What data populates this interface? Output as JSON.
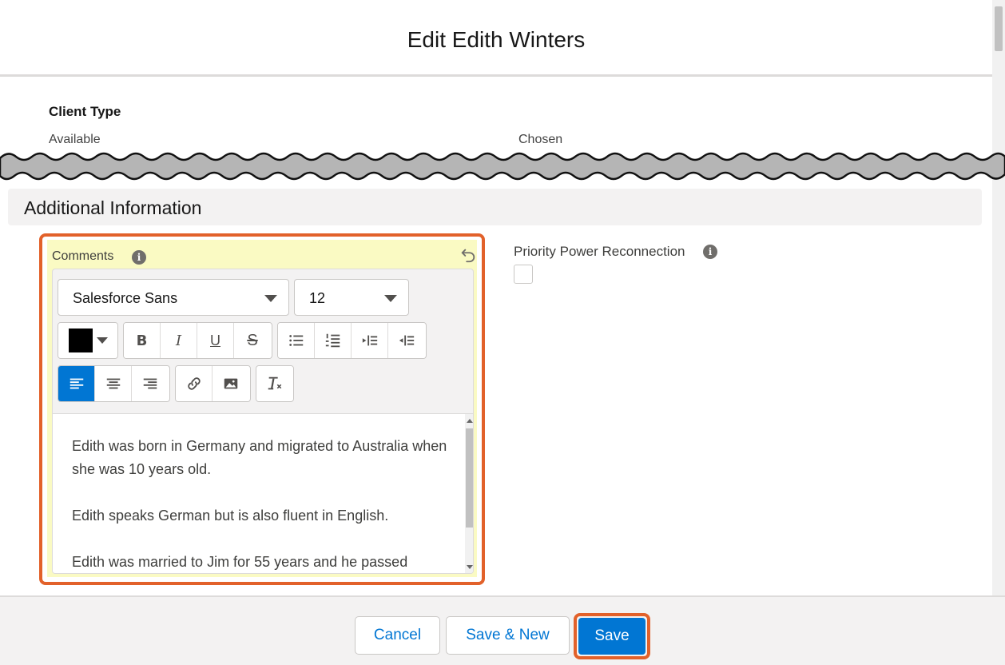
{
  "modal": {
    "title": "Edit Edith Winters"
  },
  "client_type": {
    "label": "Client Type",
    "available_label": "Available",
    "chosen_label": "Chosen"
  },
  "section": {
    "title": "Additional Information"
  },
  "comments": {
    "label": "Comments",
    "font_family": "Salesforce Sans",
    "font_size": "12",
    "text_color": "#000000",
    "paragraphs": [
      "Edith was born in Germany and migrated to Australia when she was 10 years old.",
      "Edith speaks German but is also fluent in English.",
      "Edith was married to Jim for 55 years and he passed"
    ],
    "toolbar": {
      "color_icon": "text-color-icon",
      "format": [
        "bold-icon",
        "italic-icon",
        "underline-icon",
        "strikethrough-icon"
      ],
      "lists": [
        "bullet-list-icon",
        "numbered-list-icon",
        "indent-icon",
        "outdent-icon"
      ],
      "align": [
        "align-left-icon",
        "align-center-icon",
        "align-right-icon"
      ],
      "insert": [
        "link-icon",
        "image-icon"
      ],
      "clear": "clear-formatting-icon",
      "active_align": "left"
    }
  },
  "priority": {
    "label": "Priority Power Reconnection",
    "checked": false
  },
  "footer": {
    "cancel": "Cancel",
    "save_new": "Save & New",
    "save": "Save"
  },
  "colors": {
    "brand": "#0176d3",
    "highlight": "#e2612a",
    "field_bg": "#fafac3"
  }
}
